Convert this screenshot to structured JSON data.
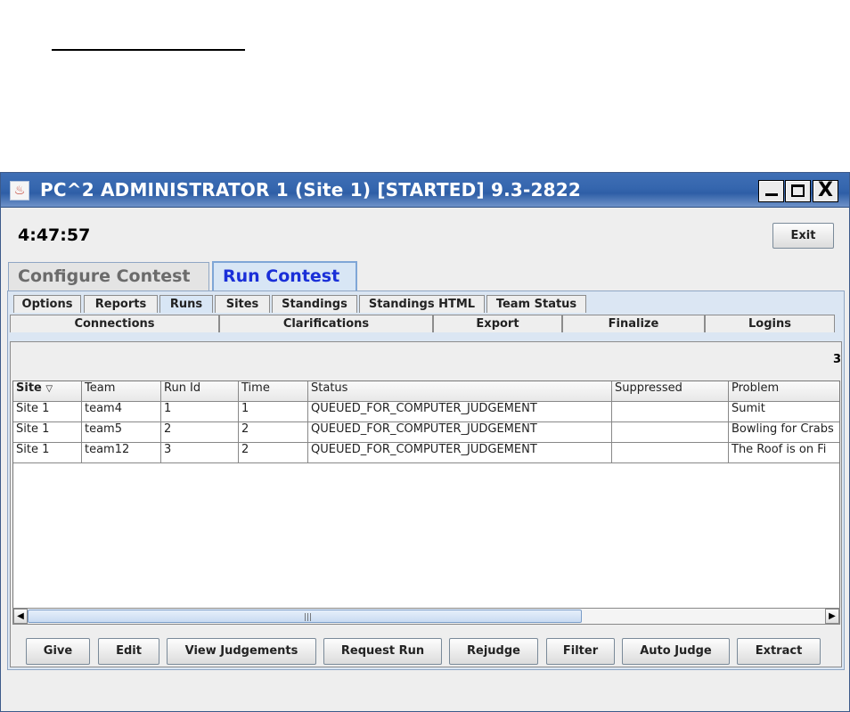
{
  "window": {
    "title": "PC^2 ADMINISTRATOR 1 (Site 1) [STARTED] 9.3-2822",
    "controls": {
      "minimize": "_",
      "maximize": "□",
      "close": "X"
    }
  },
  "header": {
    "clock": "4:47:57",
    "exit_label": "Exit"
  },
  "main_tabs": [
    {
      "label": "Configure Contest",
      "active": false
    },
    {
      "label": "Run Contest",
      "active": true
    }
  ],
  "sub_tabs_row1": [
    "Options",
    "Reports",
    "Runs",
    "Sites",
    "Standings",
    "Standings HTML",
    "Team Status"
  ],
  "sub_tabs_row2": [
    "Connections",
    "Clarifications",
    "Export",
    "Finalize",
    "Logins"
  ],
  "active_sub_tab": "Runs",
  "runs": {
    "count": "3",
    "columns": [
      "Site",
      "Team",
      "Run Id",
      "Time",
      "Status",
      "Suppressed",
      "Problem"
    ],
    "sort_indicator": "▽",
    "rows": [
      [
        "Site 1",
        "team4",
        "1",
        "1",
        "QUEUED_FOR_COMPUTER_JUDGEMENT",
        "",
        "Sumit"
      ],
      [
        "Site 1",
        "team5",
        "2",
        "2",
        "QUEUED_FOR_COMPUTER_JUDGEMENT",
        "",
        "Bowling for Crabs"
      ],
      [
        "Site 1",
        "team12",
        "3",
        "2",
        "QUEUED_FOR_COMPUTER_JUDGEMENT",
        "",
        "The Roof is on Fi"
      ]
    ]
  },
  "actions": [
    "Give",
    "Edit",
    "View Judgements",
    "Request Run",
    "Rejudge",
    "Filter",
    "Auto Judge",
    "Extract"
  ],
  "scrollbar": {
    "left_arrow": "◀",
    "right_arrow": "▶",
    "grip": "|||"
  }
}
